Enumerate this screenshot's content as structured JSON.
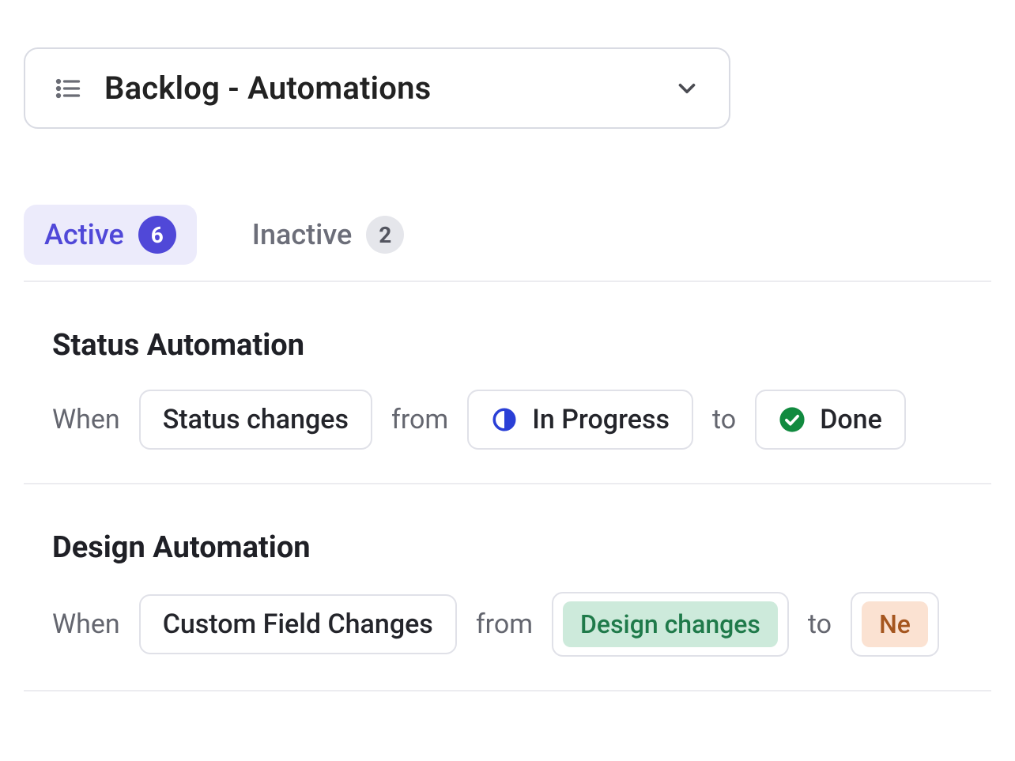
{
  "dropdown": {
    "title": "Backlog -  Automations"
  },
  "tabs": {
    "active": {
      "label": "Active",
      "count": "6"
    },
    "inactive": {
      "label": "Inactive",
      "count": "2"
    }
  },
  "sections": [
    {
      "title": "Status Automation",
      "when": "When",
      "trigger": "Status changes",
      "from_word": "from",
      "from_value": "In Progress",
      "to_word": "to",
      "to_value": "Done"
    },
    {
      "title": "Design Automation",
      "when": "When",
      "trigger": "Custom Field Changes",
      "from_word": "from",
      "from_value": "Design changes",
      "to_word": "to",
      "to_value": "Ne"
    }
  ]
}
